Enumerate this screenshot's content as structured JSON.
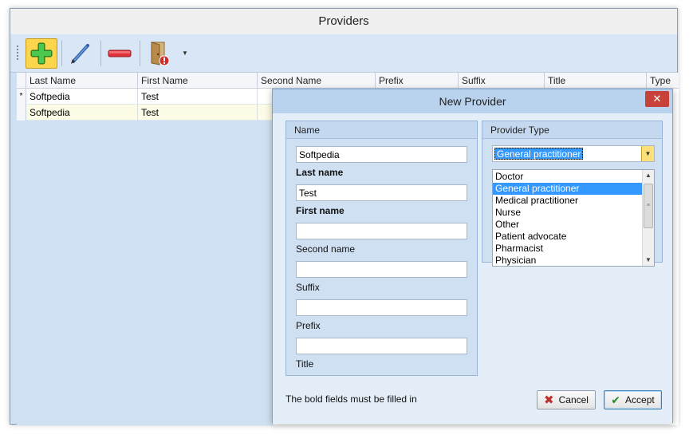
{
  "window": {
    "title": "Providers"
  },
  "toolbar": {
    "add_icon": "plus-icon",
    "edit_icon": "pencil-icon",
    "delete_icon": "minus-icon",
    "exit_icon": "door-exit-icon",
    "more_icon": "chevron-down-icon"
  },
  "grid": {
    "columns": [
      "Last Name",
      "First Name",
      "Second Name",
      "Prefix",
      "Suffix",
      "Title",
      "Type"
    ],
    "row_marker": "*",
    "rows": [
      {
        "last_name": "Softpedia",
        "first_name": "Test"
      },
      {
        "last_name": "Softpedia",
        "first_name": "Test"
      }
    ]
  },
  "dialog": {
    "title": "New Provider",
    "close_label": "✕",
    "name_panel": {
      "title": "Name",
      "fields": [
        {
          "value": "Softpedia",
          "label": "Last name"
        },
        {
          "value": "Test",
          "label": "First name"
        },
        {
          "value": "",
          "label": "Second name"
        },
        {
          "value": "",
          "label": "Suffix"
        },
        {
          "value": "",
          "label": "Prefix"
        },
        {
          "value": "",
          "label": "Title"
        }
      ]
    },
    "type_panel": {
      "title": "Provider Type",
      "selected": "General practitioner",
      "options": [
        "Doctor",
        "General practitioner",
        "Medical practitioner",
        "Nurse",
        "Other",
        "Patient advocate",
        "Pharmacist",
        "Physician"
      ]
    },
    "hint": "The bold fields must be filled in",
    "cancel_label": "Cancel",
    "accept_label": "Accept"
  },
  "colors": {
    "accent": "#3399ff",
    "close": "#c7433a"
  }
}
